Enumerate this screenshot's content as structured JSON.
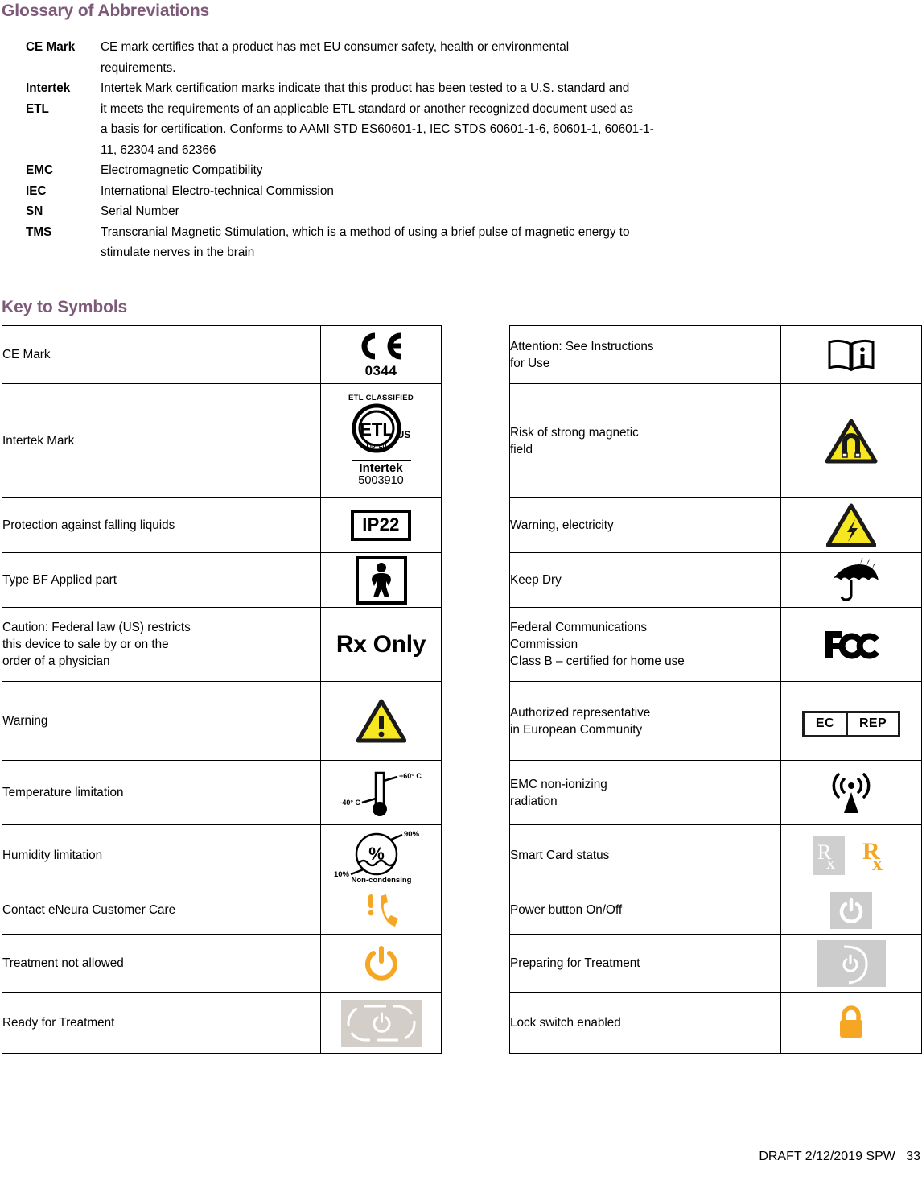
{
  "glossary": {
    "heading": "Glossary of Abbreviations",
    "entries": [
      {
        "term": "CE Mark",
        "lines": [
          "CE mark certifies that a product has met EU consumer safety, health or environmental",
          "requirements."
        ]
      },
      {
        "term": "Intertek",
        "term2": "ETL",
        "lines": [
          "Intertek Mark certification marks indicate that this product has been tested to a U.S. standard and",
          "it meets the requirements of an applicable ETL standard or another recognized document used as",
          "a basis for certification.  Conforms to AAMI STD ES60601-1, IEC STDS 60601-1-6, 60601-1, 60601-1-",
          "11, 62304 and 62366"
        ]
      },
      {
        "term": "EMC",
        "lines": [
          "Electromagnetic Compatibility"
        ]
      },
      {
        "term": "IEC",
        "lines": [
          "International Electro-technical Commission"
        ]
      },
      {
        "term": "SN",
        "lines": [
          "Serial Number"
        ]
      },
      {
        "term": "TMS",
        "lines": [
          "Transcranial Magnetic Stimulation, which is a method of using a brief pulse of magnetic energy to",
          "stimulate nerves in the brain"
        ]
      }
    ]
  },
  "symbols": {
    "heading": "Key to Symbols",
    "left_rows": [
      {
        "desc": [
          "CE Mark"
        ],
        "icon": "ce-mark-icon",
        "ce_number": "0344"
      },
      {
        "desc": [
          "Intertek Mark"
        ],
        "icon": "intertek-etl-icon",
        "etl_classified": "ETL CLASSIFIED",
        "etl_letters": "ETL",
        "etl_listed": "LISTED",
        "etl_us": "US",
        "etl_name": "Intertek",
        "etl_number": "5003910"
      },
      {
        "desc": [
          "Protection against falling liquids"
        ],
        "icon": "ip-rating-icon",
        "ip_code": "IP22"
      },
      {
        "desc": [
          "Type BF Applied part"
        ],
        "icon": "type-bf-applied-part-icon"
      },
      {
        "desc": [
          "Caution: Federal law (US) restricts",
          "this device to sale by or on the",
          "order of a physician"
        ],
        "icon": "rx-only-icon",
        "rx_text": "Rx Only"
      },
      {
        "desc": [
          "Warning"
        ],
        "icon": "warning-triangle-icon"
      },
      {
        "desc": [
          "Temperature limitation"
        ],
        "icon": "temperature-limitation-icon",
        "temp_high": "+60° C",
        "temp_low": "-40° C"
      },
      {
        "desc": [
          "Humidity limitation"
        ],
        "icon": "humidity-limitation-icon",
        "humidity_high": "90%",
        "humidity_low": "10%",
        "humidity_note": "Non-condensing"
      },
      {
        "desc": [
          "Contact eNeura Customer Care"
        ],
        "icon": "phone-alert-icon"
      },
      {
        "desc": [
          "Treatment not allowed"
        ],
        "icon": "power-orange-icon"
      },
      {
        "desc": [
          "Ready for Treatment"
        ],
        "icon": "ready-treatment-button-icon"
      }
    ],
    "right_rows": [
      {
        "desc": [
          "Attention: See Instructions",
          "for Use"
        ],
        "icon": "instructions-for-use-icon"
      },
      {
        "desc": [
          "Risk of strong magnetic",
          "field"
        ],
        "icon": "magnetic-field-warning-icon"
      },
      {
        "desc": [
          "Warning, electricity"
        ],
        "icon": "electricity-warning-icon"
      },
      {
        "desc": [
          "Keep Dry"
        ],
        "icon": "keep-dry-umbrella-icon"
      },
      {
        "desc": [
          "Federal Communications",
          "Commission",
          "Class B – certified for home use"
        ],
        "icon": "fcc-icon"
      },
      {
        "desc": [
          "Authorized representative",
          "in European Community"
        ],
        "icon": "ec-rep-icon",
        "ec_label": "EC",
        "rep_label": "REP"
      },
      {
        "desc": [
          "EMC non-ionizing",
          "radiation"
        ],
        "icon": "non-ionizing-radiation-icon"
      },
      {
        "desc": [
          "Smart Card status"
        ],
        "icon": "smart-card-status-icon"
      },
      {
        "desc": [
          "Power button On/Off"
        ],
        "icon": "power-button-icon"
      },
      {
        "desc": [
          "Preparing for Treatment"
        ],
        "icon": "preparing-treatment-icon"
      },
      {
        "desc": [
          "Lock switch enabled"
        ],
        "icon": "lock-closed-icon"
      }
    ]
  },
  "footer": {
    "text": "DRAFT 2/12/2019 SPW   33"
  },
  "colors": {
    "heading": "#7D5A78",
    "warning_yellow": "#F7E720",
    "accent_orange": "#F5A623",
    "grey_button": "#cccccc"
  }
}
